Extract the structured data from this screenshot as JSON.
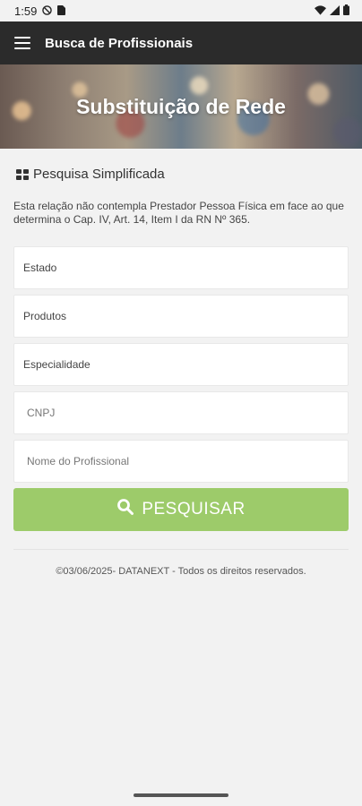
{
  "status_bar": {
    "time": "1:59",
    "icons": [
      "no-disturb-icon",
      "sim-icon",
      "wifi-icon",
      "signal-icon",
      "battery-icon"
    ]
  },
  "app_bar": {
    "title": "Busca de Profissionais",
    "menu_icon": "menu-icon"
  },
  "banner": {
    "title": "Substituição de Rede"
  },
  "section": {
    "icon": "grid-icon",
    "title": "Pesquisa Simplificada"
  },
  "notice": "Esta relação não contempla Prestador Pessoa Física em face ao que determina o Cap. IV, Art. 14, Item I da RN Nº 365.",
  "fields": {
    "estado": "Estado",
    "produtos": "Produtos",
    "especialidade": "Especialidade",
    "cnpj_placeholder": "CNPJ",
    "nome_placeholder": "Nome do Profissional"
  },
  "search_button": {
    "label": "PESQUISAR",
    "icon": "search-icon",
    "color": "#9dcb6a"
  },
  "footer": "©03/06/2025- DATANEXT - Todos os direitos reservados.",
  "colors": {
    "app_bar": "#2b2b2b",
    "background": "#f2f2f2"
  }
}
